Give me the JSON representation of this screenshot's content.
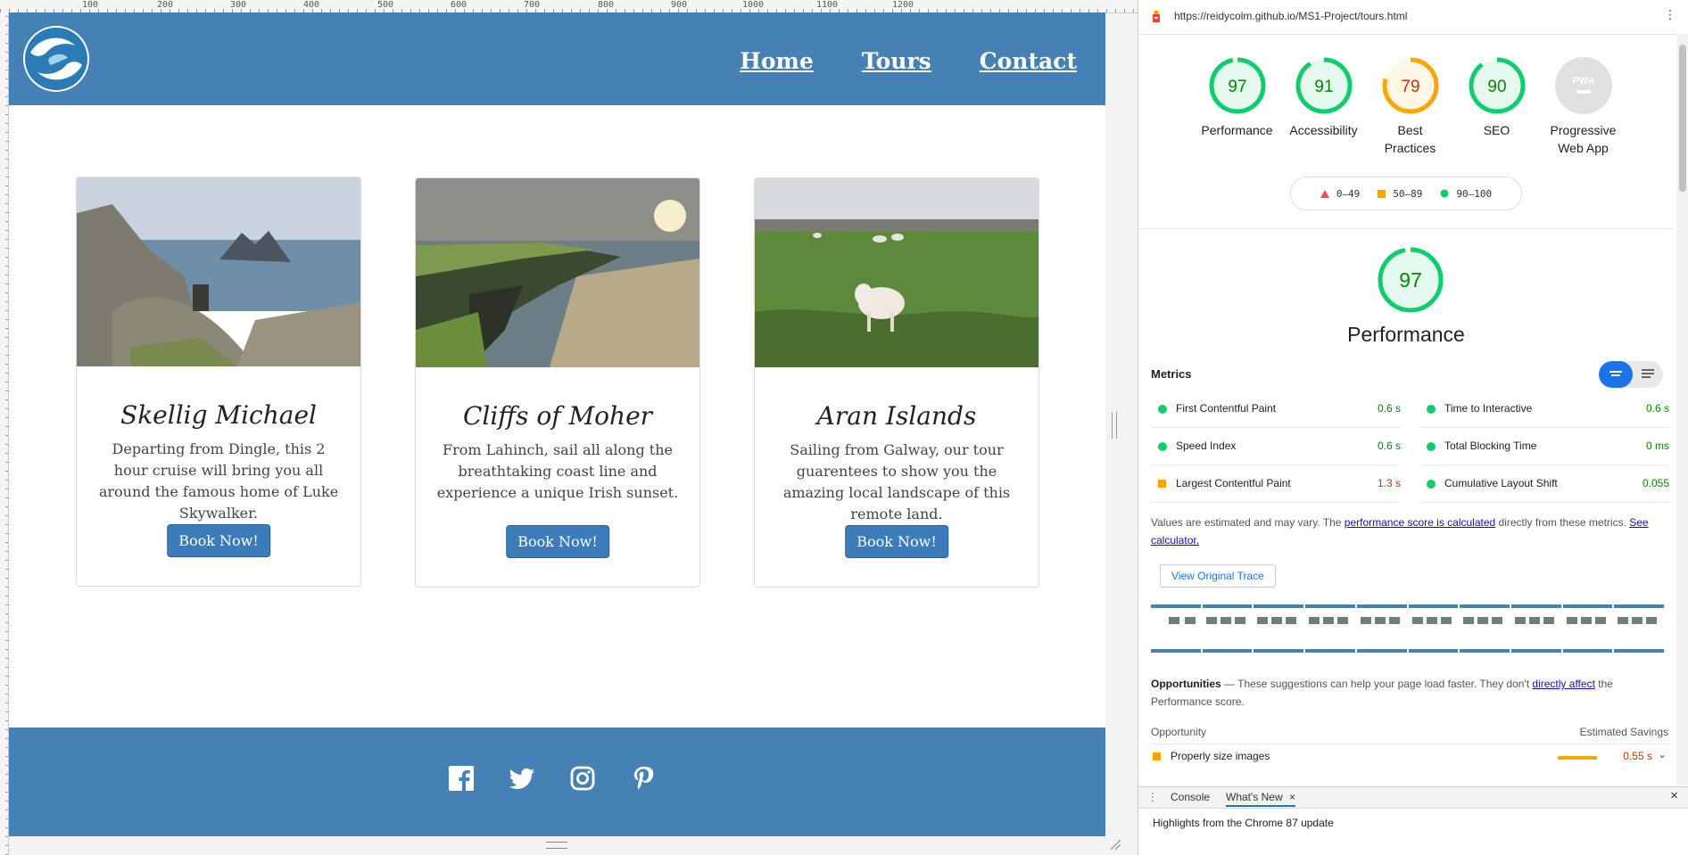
{
  "ruler": {
    "numbers": [
      "100",
      "200",
      "300",
      "400",
      "500",
      "600",
      "700",
      "800",
      "900",
      "1000",
      "1100",
      "1200"
    ]
  },
  "site": {
    "nav": {
      "home": "Home",
      "tours": "Tours",
      "contact": "Contact"
    },
    "cards": [
      {
        "title": "Skellig Michael",
        "text": "Departing from Dingle, this 2 hour cruise will bring you all around the famous home of Luke Skywalker.",
        "button": "Book Now!"
      },
      {
        "title": "Cliffs of Moher",
        "text": "From Lahinch, sail all along the breathtaking coast line and experience a unique Irish sunset.",
        "button": "Book Now!"
      },
      {
        "title": "Aran Islands",
        "text": "Sailing from Galway, our tour guarentees to show you the amazing local landscape of this remote land.",
        "button": "Book Now!"
      }
    ],
    "social": [
      "facebook-icon",
      "twitter-icon",
      "instagram-icon",
      "pinterest-icon"
    ],
    "colors": {
      "brand": "#4581b4",
      "button": "#3c7cba"
    }
  },
  "devtools": {
    "url": "https://reidycolm.github.io/MS1-Project/tours.html",
    "scores": [
      {
        "label": "Performance",
        "value": "97",
        "level": "pass",
        "fraction": 0.97
      },
      {
        "label": "Accessibility",
        "value": "91",
        "level": "pass",
        "fraction": 0.91
      },
      {
        "label": "Best Practices",
        "value": "79",
        "level": "average",
        "fraction": 0.79
      },
      {
        "label": "SEO",
        "value": "90",
        "level": "pass",
        "fraction": 0.9
      },
      {
        "label": "Progressive Web App",
        "value": "PWA",
        "level": "na",
        "fraction": 0
      }
    ],
    "legend": {
      "fail": "0–49",
      "average": "50–89",
      "pass": "90–100"
    },
    "category": {
      "score": "97",
      "title": "Performance"
    },
    "metrics_title": "Metrics",
    "metrics": [
      {
        "name": "First Contentful Paint",
        "value": "0.6 s",
        "level": "pass"
      },
      {
        "name": "Time to Interactive",
        "value": "0.6 s",
        "level": "pass"
      },
      {
        "name": "Speed Index",
        "value": "0.6 s",
        "level": "pass"
      },
      {
        "name": "Total Blocking Time",
        "value": "0 ms",
        "level": "pass"
      },
      {
        "name": "Largest Contentful Paint",
        "value": "1.3 s",
        "level": "average"
      },
      {
        "name": "Cumulative Layout Shift",
        "value": "0.055",
        "level": "pass"
      }
    ],
    "note": {
      "pre": "Values are estimated and may vary. The ",
      "link1": "performance score is calculated",
      "mid": " directly from these metrics. ",
      "link2": "See calculator."
    },
    "trace_button": "View Original Trace",
    "opportunities": {
      "title": "Opportunities",
      "desc_pre": " — These suggestions can help your page load faster. They don't ",
      "desc_link": "directly affect",
      "desc_post": " the Performance score.",
      "col_opportunity": "Opportunity",
      "col_savings": "Estimated Savings",
      "rows": [
        {
          "name": "Properly size images",
          "savings": "0.55 s",
          "fraction": 0.55
        }
      ]
    },
    "drawer": {
      "tabs": [
        "Console",
        "What's New"
      ],
      "close": "×",
      "body": "Highlights from the Chrome 87 update"
    },
    "colors": {
      "pass": "#0cce6b",
      "average": "#ffa400",
      "fail": "#ff4e42",
      "na": "#9e9e9e"
    }
  }
}
